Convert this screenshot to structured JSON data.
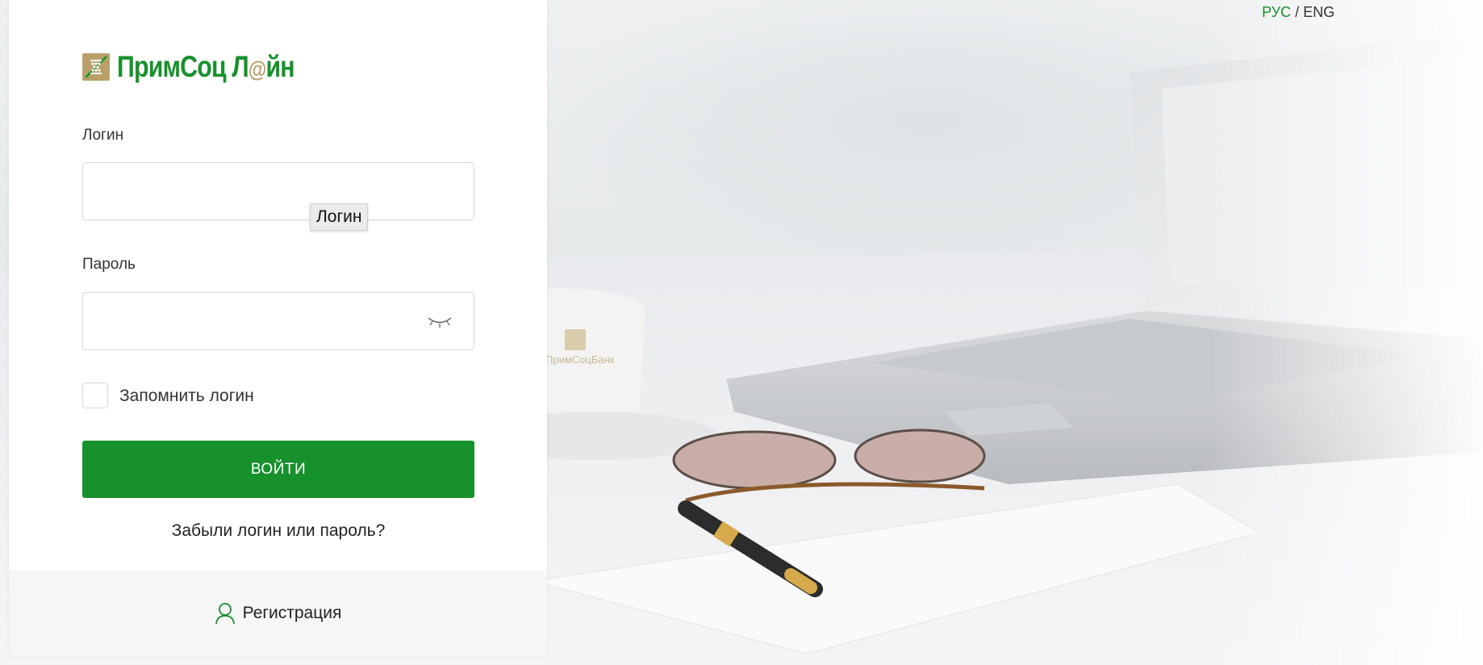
{
  "language": {
    "ru": "РУС",
    "separator": "/",
    "en": "ENG",
    "active_color": "#17912b"
  },
  "brand": {
    "name_part1": "ПримСоц Л",
    "name_at": "@",
    "name_part2": "йн",
    "mug_text": "ПримСоцБанк",
    "primary_color": "#17912b",
    "gold_color": "#b9a06a"
  },
  "form": {
    "login_label": "Логин",
    "login_value": "",
    "login_tooltip": "Логин",
    "password_label": "Пароль",
    "password_value": "",
    "remember_label": "Запомнить логин",
    "remember_checked": false,
    "submit_label": "ВОЙТИ",
    "forgot_link": "Забыли логин или пароль?"
  },
  "footer": {
    "register_label": "Регистрация",
    "register_icon": "user-icon",
    "password_toggle_icon": "eye-closed-icon"
  }
}
